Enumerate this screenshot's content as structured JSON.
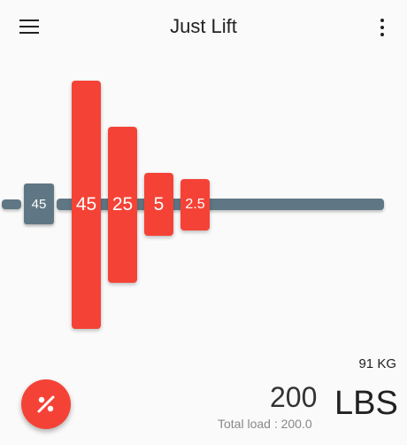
{
  "app": {
    "title": "Just Lift"
  },
  "collar": {
    "label": "45"
  },
  "plates": [
    {
      "label": "45"
    },
    {
      "label": "25"
    },
    {
      "label": "5"
    },
    {
      "label": "2.5"
    }
  ],
  "summary": {
    "kg": "91 KG",
    "weight": "200",
    "unit": "LBS",
    "total_load": "Total load : 200.0"
  },
  "colors": {
    "plate": "#f44336",
    "bar": "#5f7784",
    "fab": "#f44336"
  },
  "icons": {
    "menu": "hamburger-menu-icon",
    "more": "more-vert-icon",
    "fab": "percent-icon"
  }
}
